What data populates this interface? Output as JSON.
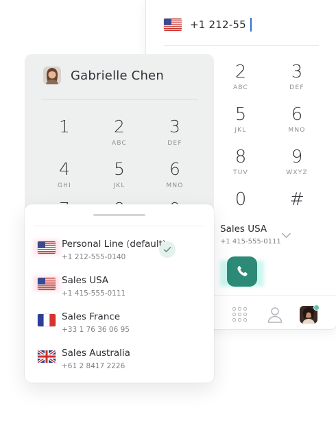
{
  "back_dialer": {
    "country_flag": "us-flag-icon",
    "dialed_number": "+1 212-55",
    "keys": [
      {
        "digit": "2",
        "letters": "ABC"
      },
      {
        "digit": "3",
        "letters": "DEF"
      },
      {
        "digit": "5",
        "letters": "JKL"
      },
      {
        "digit": "6",
        "letters": "MNO"
      },
      {
        "digit": "8",
        "letters": "TUV"
      },
      {
        "digit": "9",
        "letters": "WXYZ"
      },
      {
        "digit": "0",
        "letters": ""
      },
      {
        "digit": "#",
        "letters": ""
      }
    ],
    "selected_line": {
      "name": "Sales USA",
      "number": "+1 415-555-0111"
    },
    "call_button_color": "#2c8a76",
    "nav": [
      "keypad-icon",
      "contacts-icon",
      "profile-avatar"
    ]
  },
  "front_dialer": {
    "user_name": "Gabrielle Chen",
    "keys": [
      {
        "digit": "1",
        "letters": ""
      },
      {
        "digit": "2",
        "letters": "ABC"
      },
      {
        "digit": "3",
        "letters": "DEF"
      },
      {
        "digit": "4",
        "letters": "GHI"
      },
      {
        "digit": "5",
        "letters": "JKL"
      },
      {
        "digit": "6",
        "letters": "MNO"
      },
      {
        "digit": "7",
        "letters": ""
      },
      {
        "digit": "8",
        "letters": ""
      },
      {
        "digit": "9",
        "letters": ""
      }
    ]
  },
  "line_picker": {
    "lines": [
      {
        "name": "Personal Line",
        "suffix_open": " (",
        "suffix": "default",
        "suffix_close": ")",
        "number": "+1 212-555-0140",
        "flag": "us-flag-icon",
        "selected": true
      },
      {
        "name": "Sales USA",
        "number": "+1 415-555-0111",
        "flag": "us-flag-icon",
        "selected": false
      },
      {
        "name": "Sales France",
        "number": "+33 1 76 36 06 95",
        "flag": "fr-flag-icon",
        "selected": false
      },
      {
        "name": "Sales Australia",
        "number": "+61 2 8417 2226",
        "flag": "uk-flag-icon",
        "selected": false
      }
    ]
  }
}
